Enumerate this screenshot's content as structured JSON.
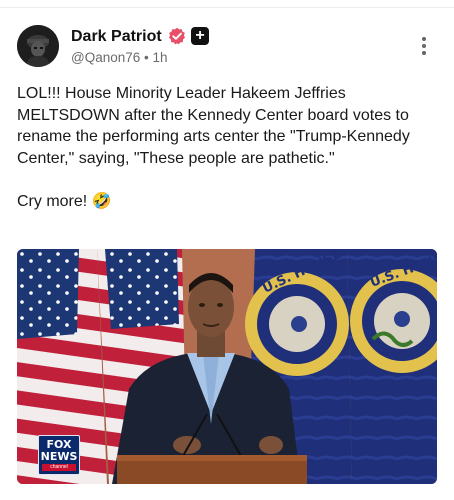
{
  "post": {
    "author": {
      "display_name": "Dark Patriot",
      "handle": "@Qanon76",
      "separator": "•",
      "time": "1h",
      "avatar_icon": "hooded-figure-avatar",
      "verified_icon": "verified-check-icon",
      "badge_icon": "plus-badge-icon",
      "verified_color": "#e8506a"
    },
    "more_icon": "more-vertical-icon",
    "text_paragraphs": [
      "LOL!!! House Minority Leader Hakeem Jeffries MELTSDOWN after the Kennedy Center board votes to rename the performing arts center the \"Trump-Kennedy Center,\" saying, \"These people are pathetic.\"",
      "Cry more! 🤣"
    ],
    "media": {
      "type": "image",
      "seal_text": "U.S. HOUSE OF REPRESENTATIVES",
      "seal_text_visible_left": "U.S. HOUSE OF",
      "seal_text_visible_right": "U.S. HOUSE OF",
      "network_logo": {
        "line1": "FOX",
        "line2": "NEWS",
        "line3": "channel"
      }
    }
  }
}
